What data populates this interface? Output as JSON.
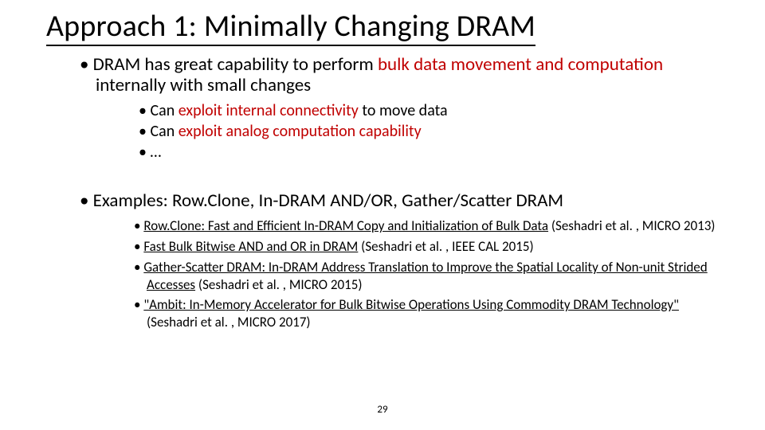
{
  "title": "Approach 1: Minimally Changing DRAM",
  "b1_pre": "DRAM has great capability to perform ",
  "b1_red1": "bulk data movement and computation",
  "b1_post": " internally with small changes",
  "b1a_pre": "Can ",
  "b1a_red": "exploit internal connectivity",
  "b1a_post": " to move data",
  "b1b_pre": "Can ",
  "b1b_red": "exploit analog computation capability",
  "b1c": "…",
  "b2": "Examples: Row.Clone, In-DRAM AND/OR, Gather/Scatter DRAM",
  "ref1_title": "Row.Clone: Fast and Efficient In-DRAM Copy and Initialization of Bulk Data",
  "ref1_cite": " (Seshadri et al. , MICRO 2013)",
  "ref2_title": "Fast Bulk Bitwise AND and OR in DRAM",
  "ref2_cite": " (Seshadri et al. , IEEE CAL 2015)",
  "ref3_title": "Gather-Scatter DRAM: In-DRAM Address Translation to Improve the Spatial Locality of Non-unit Strided Accesses",
  "ref3_cite": " (Seshadri et al. , MICRO 2015)",
  "ref4_title": "\"Ambit: In-Memory Accelerator for Bulk Bitwise Operations Using Commodity DRAM Technology\"",
  "ref4_cite": " (Seshadri et al. , MICRO 2017)",
  "pagenum": "29"
}
